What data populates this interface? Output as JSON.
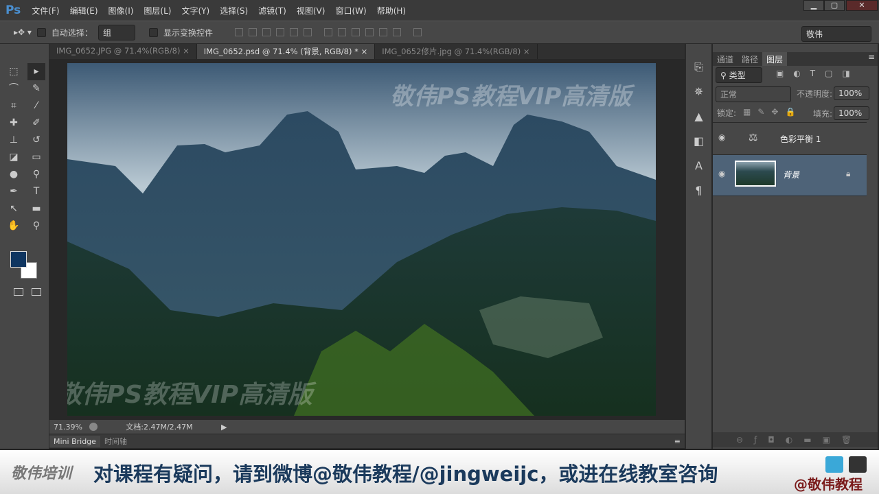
{
  "app": {
    "logo": "Ps",
    "menus": [
      "文件(F)",
      "编辑(E)",
      "图像(I)",
      "图层(L)",
      "文字(Y)",
      "选择(S)",
      "滤镜(T)",
      "视图(V)",
      "窗口(W)",
      "帮助(H)"
    ],
    "window_buttons": [
      "▁",
      "▢",
      "✕"
    ]
  },
  "options": {
    "auto_select_label": "自动选择：",
    "auto_select_value": "组",
    "show_transform_label": "显示变换控件",
    "workspace": "敬伟"
  },
  "tabs": [
    {
      "label": "IMG_0652.JPG @ 71.4%(RGB/8)",
      "active": false
    },
    {
      "label": "IMG_0652.psd @ 71.4% (背景, RGB/8) *",
      "active": true
    },
    {
      "label": "IMG_0652修片.jpg @ 71.4%(RGB/8)",
      "active": false
    }
  ],
  "canvas": {
    "watermark": "敬伟PS教程VIP高清版"
  },
  "status": {
    "zoom": "71.39%",
    "doc": "文档:2.47M/2.47M"
  },
  "bottom_tabs": [
    "Mini Bridge",
    "时间轴"
  ],
  "layers_panel": {
    "tabs": [
      "通道",
      "路径",
      "图层"
    ],
    "filter": "类型",
    "blend_mode": "正常",
    "opacity_label": "不透明度:",
    "opacity": "100%",
    "lock_label": "锁定:",
    "fill_label": "填充:",
    "fill": "100%",
    "layers": [
      {
        "name": "色彩平衡 1",
        "type": "adjustment"
      },
      {
        "name": "背景",
        "type": "image",
        "locked": true,
        "selected": true
      }
    ]
  },
  "banner": {
    "left_logo": "敬伟培训",
    "message": "对课程有疑问，请到微博@敬伟教程/@jingweijc，或进在线教室咨询",
    "handle": "@敬伟教程"
  },
  "colors": {
    "foreground": "#0f3560",
    "background": "#ffffff",
    "accent_text": "#1b3a5c",
    "handle": "#7a1a1a"
  }
}
